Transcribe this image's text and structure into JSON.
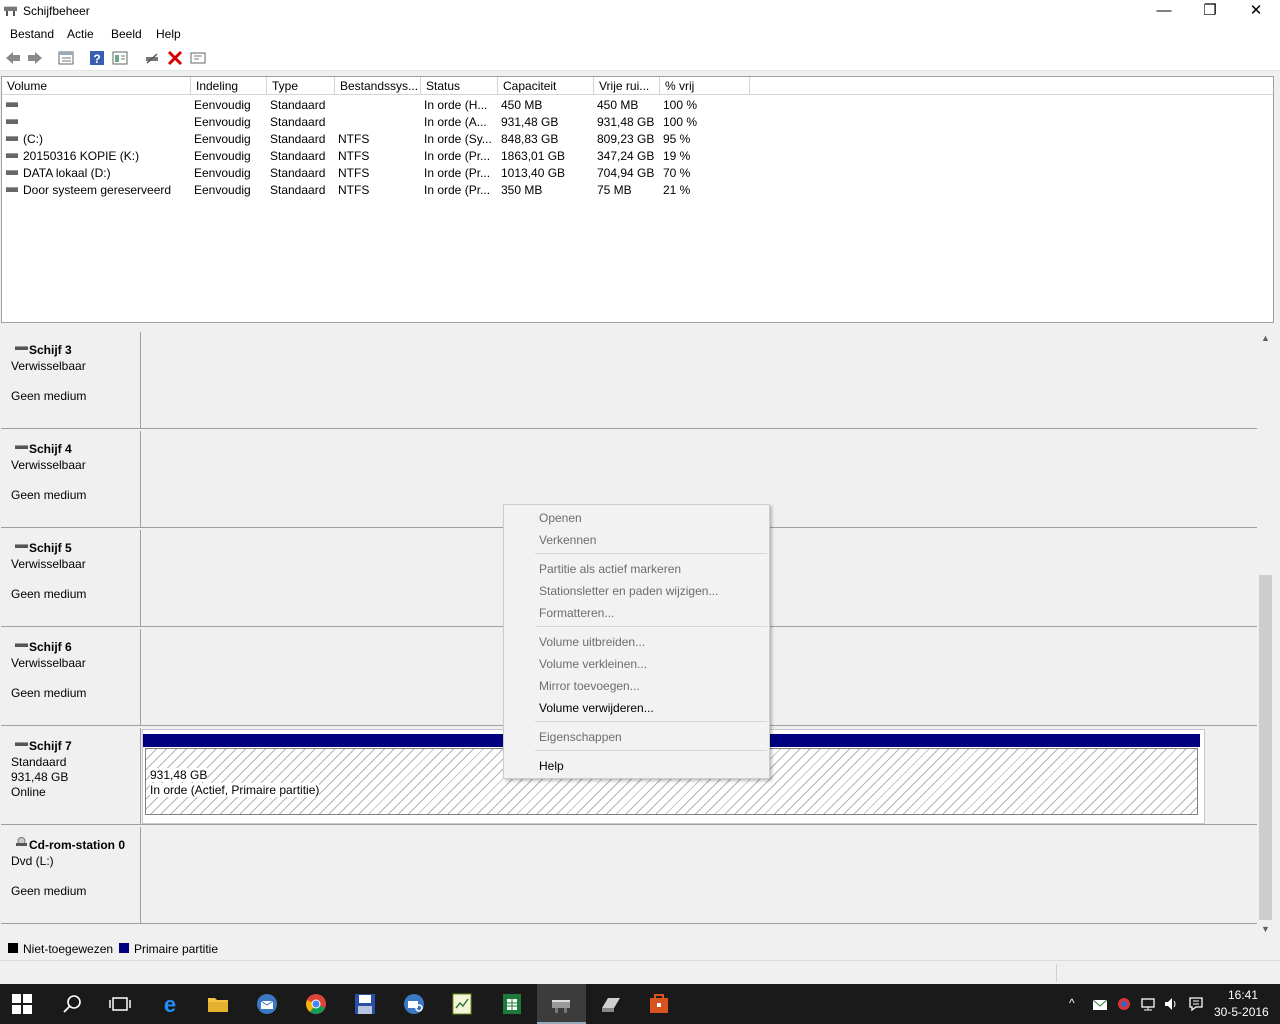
{
  "window": {
    "title": "Schijfbeheer",
    "minimize_glyph": "—",
    "restore_glyph": "❐",
    "close_glyph": "✕"
  },
  "menu": [
    "Bestand",
    "Actie",
    "Beeld",
    "Help"
  ],
  "toolbar": {
    "icons": [
      "back-icon",
      "forward-icon",
      "list-view-icon",
      "help-icon",
      "properties-icon",
      "connect-icon",
      "delete-icon",
      "settings-icon"
    ]
  },
  "volume_list": {
    "headers": [
      "Volume",
      "Indeling",
      "Type",
      "Bestandssys...",
      "Status",
      "Capaciteit",
      "Vrije rui...",
      "% vrij"
    ],
    "rows": [
      {
        "volume": "",
        "layout": "Eenvoudig",
        "type": "Standaard",
        "fs": "",
        "status": "In orde (H...",
        "capacity": "450 MB",
        "free": "450 MB",
        "pct": "100 %"
      },
      {
        "volume": "",
        "layout": "Eenvoudig",
        "type": "Standaard",
        "fs": "",
        "status": "In orde (A...",
        "capacity": "931,48 GB",
        "free": "931,48 GB",
        "pct": "100 %"
      },
      {
        "volume": "(C:)",
        "layout": "Eenvoudig",
        "type": "Standaard",
        "fs": "NTFS",
        "status": "In orde (Sy...",
        "capacity": "848,83 GB",
        "free": "809,23 GB",
        "pct": "95 %"
      },
      {
        "volume": "20150316 KOPIE (K:)",
        "layout": "Eenvoudig",
        "type": "Standaard",
        "fs": "NTFS",
        "status": "In orde (Pr...",
        "capacity": "1863,01 GB",
        "free": "347,24 GB",
        "pct": "19 %"
      },
      {
        "volume": "DATA lokaal (D:)",
        "layout": "Eenvoudig",
        "type": "Standaard",
        "fs": "NTFS",
        "status": "In orde (Pr...",
        "capacity": "1013,40 GB",
        "free": "704,94 GB",
        "pct": "70 %"
      },
      {
        "volume": "Door systeem gereserveerd",
        "layout": "Eenvoudig",
        "type": "Standaard",
        "fs": "NTFS",
        "status": "In orde (Pr...",
        "capacity": "350 MB",
        "free": "75 MB",
        "pct": "21 %"
      }
    ]
  },
  "disks": [
    {
      "name": "Schijf 3",
      "line1": "Verwisselbaar",
      "line2": "",
      "line3": "Geen medium"
    },
    {
      "name": "Schijf 4",
      "line1": "Verwisselbaar",
      "line2": "",
      "line3": "Geen medium"
    },
    {
      "name": "Schijf 5",
      "line1": "Verwisselbaar",
      "line2": "",
      "line3": "Geen medium"
    },
    {
      "name": "Schijf 6",
      "line1": "Verwisselbaar",
      "line2": "",
      "line3": "Geen medium"
    },
    {
      "name": "Schijf 7",
      "line1": "Standaard",
      "line2": "931,48 GB",
      "line3": "Online"
    },
    {
      "name": "Cd-rom-station 0",
      "line1": "Dvd (L:)",
      "line2": "",
      "line3": "Geen medium"
    }
  ],
  "partition": {
    "size": "931,48 GB",
    "status": "In orde (Actief, Primaire partitie)",
    "bar_color": "#000080"
  },
  "legend": {
    "unallocated": "Niet-toegewezen",
    "primary": "Primaire partitie",
    "unallocated_color": "#000000",
    "primary_color": "#000080"
  },
  "context_menu": {
    "items": [
      {
        "label": "Openen",
        "enabled": false
      },
      {
        "label": "Verkennen",
        "enabled": false
      },
      {
        "label": "Partitie als actief markeren",
        "enabled": false
      },
      {
        "label": "Stationsletter en paden wijzigen...",
        "enabled": false
      },
      {
        "label": "Formatteren...",
        "enabled": false
      },
      {
        "label": "Volume uitbreiden...",
        "enabled": false
      },
      {
        "label": "Volume verkleinen...",
        "enabled": false
      },
      {
        "label": "Mirror toevoegen...",
        "enabled": false
      },
      {
        "label": "Volume verwijderen...",
        "enabled": true
      },
      {
        "label": "Eigenschappen",
        "enabled": false
      },
      {
        "label": "Help",
        "enabled": true
      }
    ]
  },
  "taskbar": {
    "time": "16:41",
    "date": "30-5-2016",
    "apps": [
      "start-icon",
      "search-icon",
      "task-view-icon",
      "edge-icon",
      "explorer-icon",
      "outlook-icon",
      "chrome-icon",
      "save-app-icon",
      "mail-search-icon",
      "spreadsheet-icon",
      "excel-icon",
      "disk-management-icon",
      "scanner-icon",
      "toolbox-icon"
    ]
  }
}
